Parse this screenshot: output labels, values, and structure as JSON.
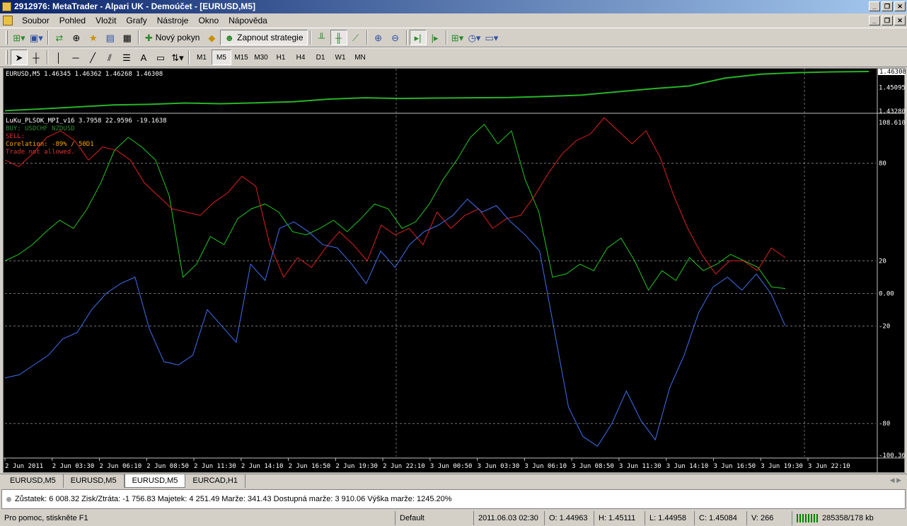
{
  "window": {
    "title": "2912976: MetaTrader - Alpari UK - Demoúčet - [EURUSD,M5]"
  },
  "menu": [
    "Soubor",
    "Pohled",
    "Vložit",
    "Grafy",
    "Nástroje",
    "Okno",
    "Nápověda"
  ],
  "toolbar": {
    "new_order_label": "Nový pokyn",
    "strategy_label": "Zapnout strategie"
  },
  "timeframes": [
    "M1",
    "M5",
    "M15",
    "M30",
    "H1",
    "H4",
    "D1",
    "W1",
    "MN"
  ],
  "active_timeframe": "M5",
  "chart": {
    "price_header": "EURUSD,M5  1.46345 1.46362 1.46268 1.46308",
    "price_axis": [
      "1.46308",
      "1.45095",
      "1.43280"
    ],
    "indicator_header": "LuKu_PLSOK_MPI_v16 3.7958 22.9596 -19.1638",
    "buy_text": "BUY: USDCHF NZDUSD",
    "sell_text": "SELL:",
    "corelation_text": "Corelation: -89% / 50D1",
    "trade_text": "Trade not allowed.",
    "indicator_axis": [
      "108.6108",
      "80",
      "20",
      "0.00",
      "-20",
      "-80",
      "-100.366"
    ],
    "time_axis": [
      "2 Jun 2011",
      "2 Jun 03:30",
      "2 Jun 06:10",
      "2 Jun 08:50",
      "2 Jun 11:30",
      "2 Jun 14:10",
      "2 Jun 16:50",
      "2 Jun 19:30",
      "2 Jun 22:10",
      "3 Jun 00:50",
      "3 Jun 03:30",
      "3 Jun 06:10",
      "3 Jun 08:50",
      "3 Jun 11:30",
      "3 Jun 14:10",
      "3 Jun 16:50",
      "3 Jun 19:30",
      "3 Jun 22:10"
    ],
    "colors": {
      "green": "#22c822",
      "red": "#e02020",
      "blue": "#4070f0",
      "price": "#28b428",
      "grid": "#b4b4b4",
      "buy": "#2e8b2e",
      "sell": "#e03030",
      "corelation": "#ffa500",
      "trade": "#e03030"
    }
  },
  "chart_data": {
    "type": "line",
    "price": [
      1.4331,
      1.4345,
      1.436,
      1.4375,
      1.438,
      1.439,
      1.4385,
      1.4392,
      1.44,
      1.442,
      1.443,
      1.4425,
      1.4428,
      1.443,
      1.4432,
      1.444,
      1.445,
      1.4475,
      1.45,
      1.452,
      1.458,
      1.461,
      1.4622,
      1.4628,
      1.4631
    ],
    "series": [
      {
        "values": [
          20,
          24,
          30,
          38,
          45,
          40,
          52,
          68,
          88,
          96,
          90,
          82,
          60,
          10,
          18,
          35,
          30,
          46,
          52,
          55,
          50,
          38,
          36,
          40,
          45,
          38,
          46,
          55,
          52,
          40,
          44,
          55,
          70,
          82,
          96,
          104,
          92,
          100,
          70,
          50,
          10,
          12,
          18,
          14,
          28,
          34,
          20,
          2,
          14,
          8,
          22,
          14,
          18,
          24,
          20,
          16,
          4,
          3
        ]
      },
      {
        "values": [
          82,
          78,
          86,
          96,
          100,
          94,
          82,
          90,
          88,
          82,
          68,
          60,
          52,
          50,
          48,
          56,
          62,
          72,
          66,
          30,
          10,
          22,
          16,
          28,
          38,
          30,
          20,
          42,
          36,
          40,
          30,
          50,
          40,
          48,
          52,
          40,
          46,
          48,
          60,
          74,
          86,
          94,
          98,
          108,
          100,
          92,
          100,
          84,
          60,
          40,
          24,
          12,
          20,
          20,
          14,
          28,
          22
        ]
      },
      {
        "values": [
          -52,
          -50,
          -44,
          -38,
          -28,
          -24,
          -10,
          0,
          6,
          10,
          -22,
          -42,
          -44,
          -38,
          -10,
          -20,
          -30,
          18,
          8,
          40,
          44,
          38,
          30,
          28,
          18,
          6,
          26,
          16,
          30,
          38,
          42,
          48,
          58,
          50,
          54,
          44,
          36,
          26,
          -22,
          -70,
          -88,
          -94,
          -80,
          -60,
          -78,
          -90,
          -58,
          -38,
          -12,
          4,
          10,
          2,
          12,
          0,
          -20
        ]
      }
    ],
    "ylim": [
      -100.366,
      108.6108
    ],
    "price_ylim": [
      1.4328,
      1.46308
    ]
  },
  "tabs": [
    "EURUSD,M5",
    "EURUSD,M5",
    "EURUSD,M5",
    "EURCAD,H1"
  ],
  "active_tab": 2,
  "terminal": {
    "summary": "Zůstatek: 6 008.32  Zisk/Ztráta: -1 756.83  Majetek: 4 251.49  Marže: 341.43  Dostupná marže: 3 910.06  Výška marže: 1245.20%"
  },
  "status": {
    "help": "Pro pomoc, stiskněte F1",
    "profile": "Default",
    "datetime": "2011.06.03 02:30",
    "open": "O: 1.44963",
    "high": "H: 1.45111",
    "low": "L: 1.44958",
    "close": "C: 1.45084",
    "volume": "V: 266",
    "traffic": "285358/178 kb"
  }
}
